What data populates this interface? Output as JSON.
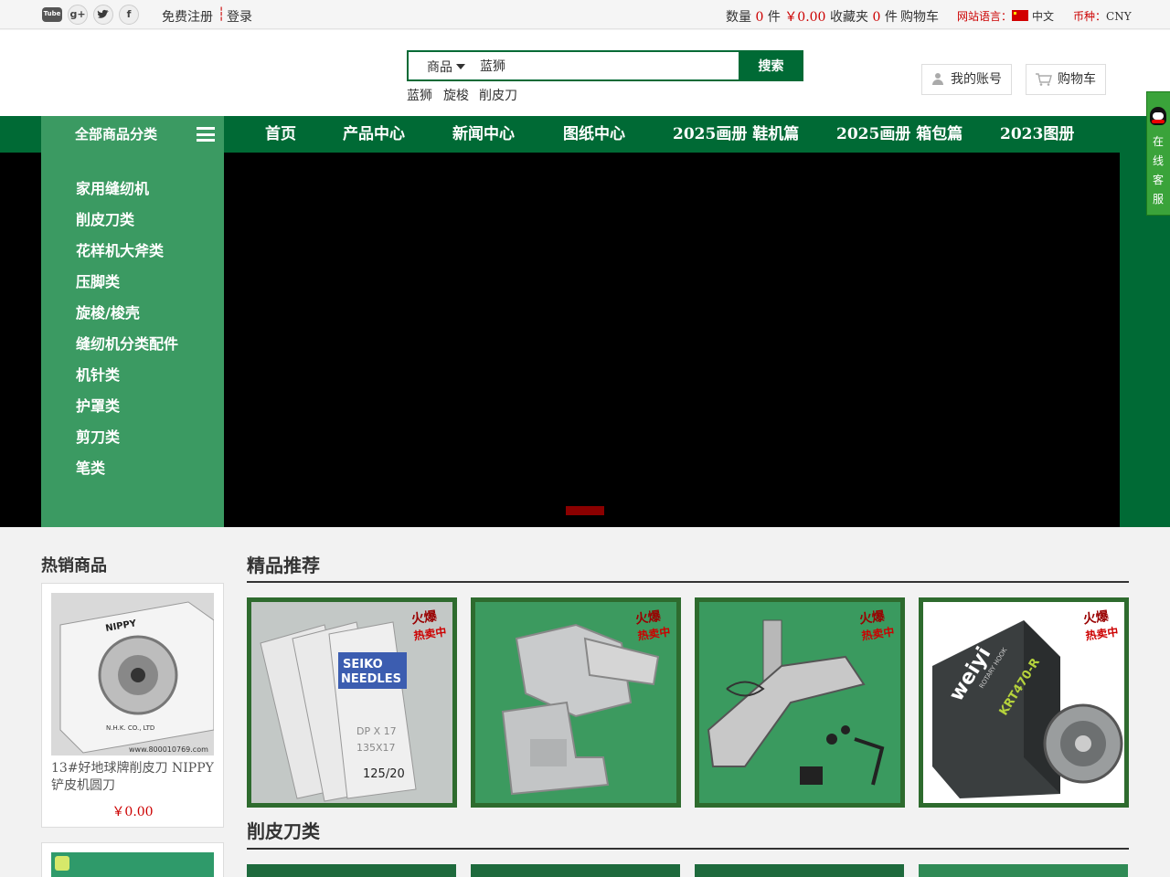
{
  "topbar": {
    "social": [
      "Tube",
      "g+",
      "twitter",
      "f"
    ],
    "register": "免费注册",
    "login": "登录",
    "qty_label": "数量",
    "qty_value": "0",
    "qty_unit": "件",
    "amount": "￥0.00",
    "fav_label": "收藏夹",
    "fav_value": "0",
    "fav_unit": "件",
    "cart": "购物车",
    "lang_label": "网站语言：",
    "lang_value": "中文",
    "currency_label": "币种：",
    "currency_value": "CNY"
  },
  "header": {
    "search_category": "商品",
    "search_value": "蓝狮",
    "search_button": "搜索",
    "hot_keywords": [
      "蓝狮",
      "旋梭",
      "削皮刀"
    ],
    "my_account": "我的账号",
    "cart": "购物车"
  },
  "nav": {
    "all_categories": "全部商品分类",
    "links": [
      "首页",
      "产品中心",
      "新闻中心",
      "图纸中心",
      "2025画册 鞋机篇",
      "2025画册 箱包篇",
      "2023图册"
    ]
  },
  "categories": [
    "家用缝纫机",
    "削皮刀类",
    "花样机大斧类",
    "压脚类",
    "旋梭/梭壳",
    "缝纫机分类配件",
    "机针类",
    "护罩类",
    "剪刀类",
    "笔类"
  ],
  "service": [
    "在",
    "线",
    "客",
    "服"
  ],
  "hot_products": {
    "title": "热销商品",
    "items": [
      {
        "name": "13#好地球牌削皮刀 NIPPY 铲皮机圆刀",
        "price": "￥0.00",
        "brand": "NIPPY",
        "maker": "N.H.K. CO., LTD",
        "watermark": "www.800010769.com"
      }
    ]
  },
  "featured": {
    "title": "精品推荐",
    "badge_top": "火爆",
    "badge_bottom": "热卖中",
    "items": [
      {
        "image": "seiko-needles",
        "label_top": "SEIKO",
        "label_mid": "NEEDLES",
        "spec1": "DP X 17",
        "spec2": "135X17",
        "size": "125/20"
      },
      {
        "image": "presser-foot"
      },
      {
        "image": "folder-attachment"
      },
      {
        "image": "rotary-hook",
        "brand": "weiyi",
        "sub": "ROTARY HOOK",
        "model": "KRT470-R"
      }
    ]
  },
  "section2": {
    "title": "削皮刀类"
  },
  "colors": {
    "brand_green": "#006a35",
    "menu_green": "#3b9a62",
    "accent_red": "#cc0000"
  }
}
